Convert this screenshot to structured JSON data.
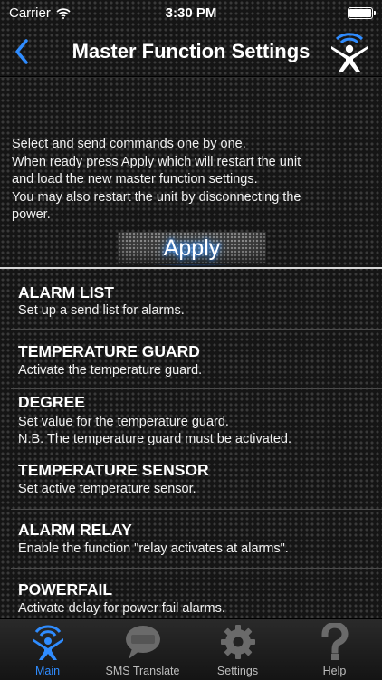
{
  "status_bar": {
    "carrier": "Carrier",
    "time": "3:30 PM",
    "battery_level": 1.0
  },
  "nav": {
    "title": "Master Function Settings",
    "back_icon": "chevron-left-icon",
    "logo_icon": "wifi-person-logo-icon"
  },
  "intro": [
    "Select and send commands one by one.",
    "When ready press Apply which will restart the unit",
    "and load the new master function settings.",
    "You may also restart the unit by disconnecting the",
    "power."
  ],
  "apply_label": "Apply",
  "items": [
    {
      "title": "ALARM LIST",
      "desc": "Set up a send list for alarms."
    },
    {
      "title": "TEMPERATURE GUARD",
      "desc": "Activate the temperature guard."
    },
    {
      "title": "DEGREE",
      "desc": "Set value for the temperature guard.\nN.B. The temperature guard must be activated."
    },
    {
      "title": "TEMPERATURE SENSOR",
      "desc": "Set active temperature sensor."
    },
    {
      "title": "ALARM RELAY",
      "desc": "Enable the function \"relay activates at alarms\"."
    },
    {
      "title": "POWERFAIL",
      "desc": "Activate delay for power fail alarms."
    }
  ],
  "tabs": [
    {
      "label": "Main",
      "icon": "person-signal-icon",
      "active": true
    },
    {
      "label": "SMS Translate",
      "icon": "sms-bubble-icon",
      "active": false
    },
    {
      "label": "Settings",
      "icon": "gear-icon",
      "active": false
    },
    {
      "label": "Help",
      "icon": "question-mark-icon",
      "active": false
    }
  ],
  "colors": {
    "accent": "#2f8cff",
    "background": "#151515",
    "tab_inactive": "#bdbdbd"
  }
}
